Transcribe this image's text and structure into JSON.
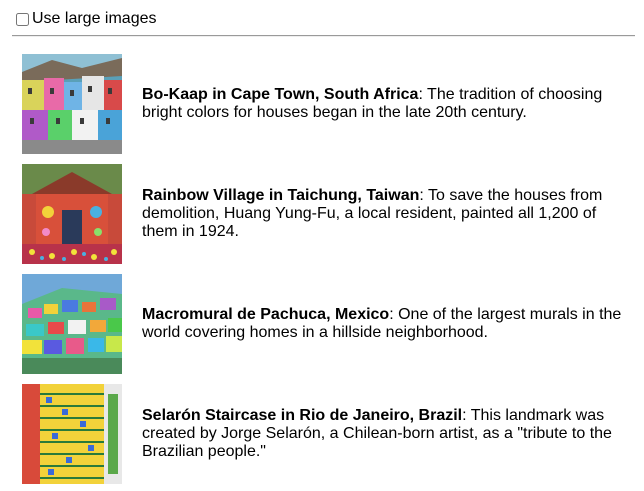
{
  "options": {
    "large_images_label": "Use large images",
    "large_images_checked": false
  },
  "items": [
    {
      "title": "Bo-Kaap in Cape Town, South Africa",
      "description": ": The tradition of choosing bright colors for houses began in the late 20th century.",
      "image_icon": "colorful-houses-photo"
    },
    {
      "title": "Rainbow Village in Taichung, Taiwan",
      "description": ": To save the houses from demolition, Huang Yung-Fu, a local resident, painted all 1,200 of them in 1924.",
      "image_icon": "painted-village-photo"
    },
    {
      "title": "Macromural de Pachuca, Mexico",
      "description": ": One of the largest murals in the world covering homes in a hillside neighborhood.",
      "image_icon": "hillside-mural-photo"
    },
    {
      "title": "Selarón Staircase in Rio de Janeiro, Brazil",
      "description": ": This landmark was created by Jorge Selarón, a Chilean-born artist, as a \"tribute to the Brazilian people.\"",
      "image_icon": "tiled-staircase-photo"
    }
  ]
}
